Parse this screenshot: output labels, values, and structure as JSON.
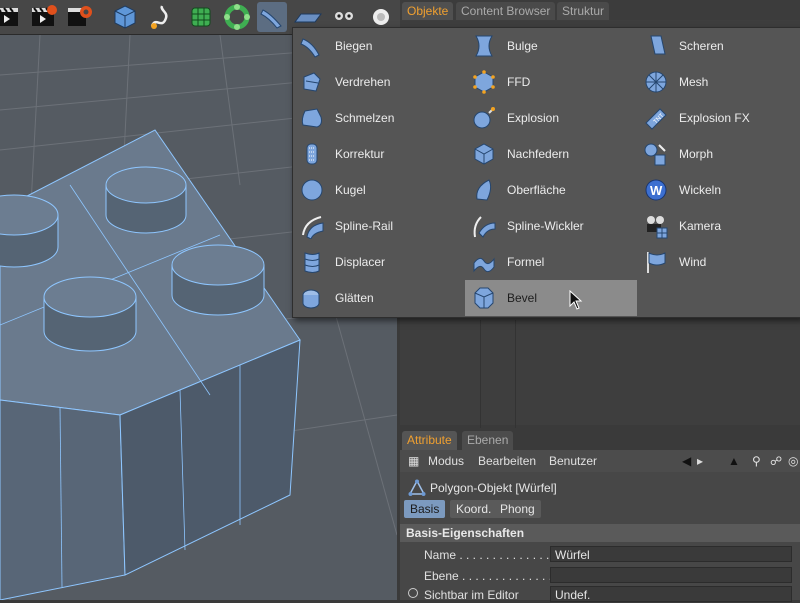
{
  "toolbar": {
    "buttons": [
      "clapboard-render-icon",
      "clapboard-render-active-icon",
      "render-settings-icon",
      "cube-icon",
      "spline-pen-icon",
      "nurbs-icon",
      "array-icon",
      "deformer-icon",
      "floor-icon",
      "camera-icon",
      "light-icon"
    ]
  },
  "object_manager": {
    "tabs": [
      "Objekte",
      "Content Browser",
      "Struktur"
    ],
    "active_tab": "Objekte"
  },
  "deformer_menu": {
    "columns": [
      [
        "Biegen",
        "Verdrehen",
        "Schmelzen",
        "Korrektur",
        "Kugel",
        "Spline-Rail",
        "Displacer",
        "Glätten"
      ],
      [
        "Bulge",
        "FFD",
        "Explosion",
        "Nachfedern",
        "Oberfläche",
        "Spline-Wickler",
        "Formel",
        "Bevel"
      ],
      [
        "Scheren",
        "Mesh",
        "Explosion FX",
        "Morph",
        "Wickeln",
        "Kamera",
        "Wind"
      ]
    ],
    "highlighted": "Bevel"
  },
  "attribute_manager": {
    "tabs": [
      "Attribute",
      "Ebenen"
    ],
    "active_tab": "Attribute",
    "menu": [
      "Modus",
      "Bearbeiten",
      "Benutzer"
    ],
    "object_title": "Polygon-Objekt [Würfel]",
    "subtabs": [
      "Basis",
      "Koord.",
      "Phong"
    ],
    "active_subtab": "Basis",
    "section": "Basis-Eigenschaften",
    "props": [
      {
        "label": "Name . . . . . . . . . . . . . . .",
        "value": "Würfel"
      },
      {
        "label": "Ebene . . . . . . . . . . . . . . .",
        "value": ""
      },
      {
        "label": "Sichtbar im Editor",
        "value": "Undef."
      }
    ]
  },
  "colors": {
    "accent": "#f0a030",
    "highlight": "#8b8b8b",
    "icon_blue": "#6e9ad4"
  }
}
